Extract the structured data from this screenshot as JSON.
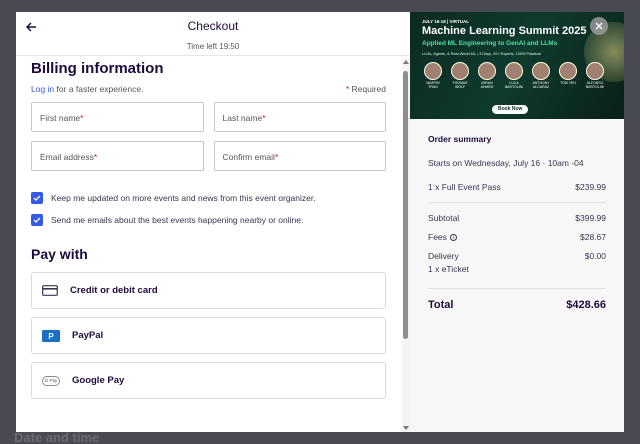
{
  "header": {
    "title": "Checkout",
    "timer": "Time left 19:50"
  },
  "billing": {
    "heading": "Billing information",
    "login_link": "Log in",
    "login_suffix": " for a faster experience.",
    "required_star": "*",
    "required_text": " Required",
    "fields": {
      "first_name": "First name",
      "last_name": "Last name",
      "email": "Email address",
      "confirm_email": "Confirm email",
      "star": "*"
    },
    "checkboxes": [
      "Keep me updated on more events and news from this event organizer.",
      "Send me emails about the best events happening nearby or online."
    ]
  },
  "pay": {
    "heading": "Pay with",
    "options": [
      "Credit or debit card",
      "PayPal",
      "Google Pay"
    ],
    "gpay_glyph": "G Pay"
  },
  "backdrop": {
    "text": "Date and time"
  },
  "banner": {
    "date": "JULY 16-18 | VIRTUAL",
    "title": "Machine Learning Summit 2025",
    "subtitle": "Applied ML Engineering to GenAI and LLMs",
    "small": "LLMs, Agents, & Real-World ML • 3 Days, 20+ Experts, 100% Practical",
    "speakers": [
      "MARTIN TRAN",
      "THOMAS WOLF",
      "IMRAN AHMED",
      "LUCA BARTOLINI",
      "ANTHONY ALCARAZ",
      "TOM YEH",
      "ALFONSO BARTOLINI"
    ],
    "book_now": "Book Now"
  },
  "summary": {
    "title": "Order summary",
    "starts": "Starts on Wednesday, July 16 · 10am -04",
    "ticket_label": "1 x Full Event Pass",
    "ticket_price": "$239.99",
    "subtotal_label": "Subtotal",
    "subtotal": "$399.99",
    "fees_label": "Fees",
    "fees": "$28.67",
    "delivery_label": "Delivery",
    "delivery": "$0.00",
    "etix": "1 x eTicket",
    "total_label": "Total",
    "total": "$428.66"
  },
  "colors": {
    "accent": "#3659e3",
    "required": "#c5162e",
    "banner_bg": "#0b2a22",
    "banner_accent": "#4be0a2"
  },
  "icons": {
    "back": "arrow-left-icon",
    "close": "close-icon",
    "card": "credit-card-icon",
    "paypal": "paypal-icon",
    "gpay": "google-pay-icon"
  }
}
